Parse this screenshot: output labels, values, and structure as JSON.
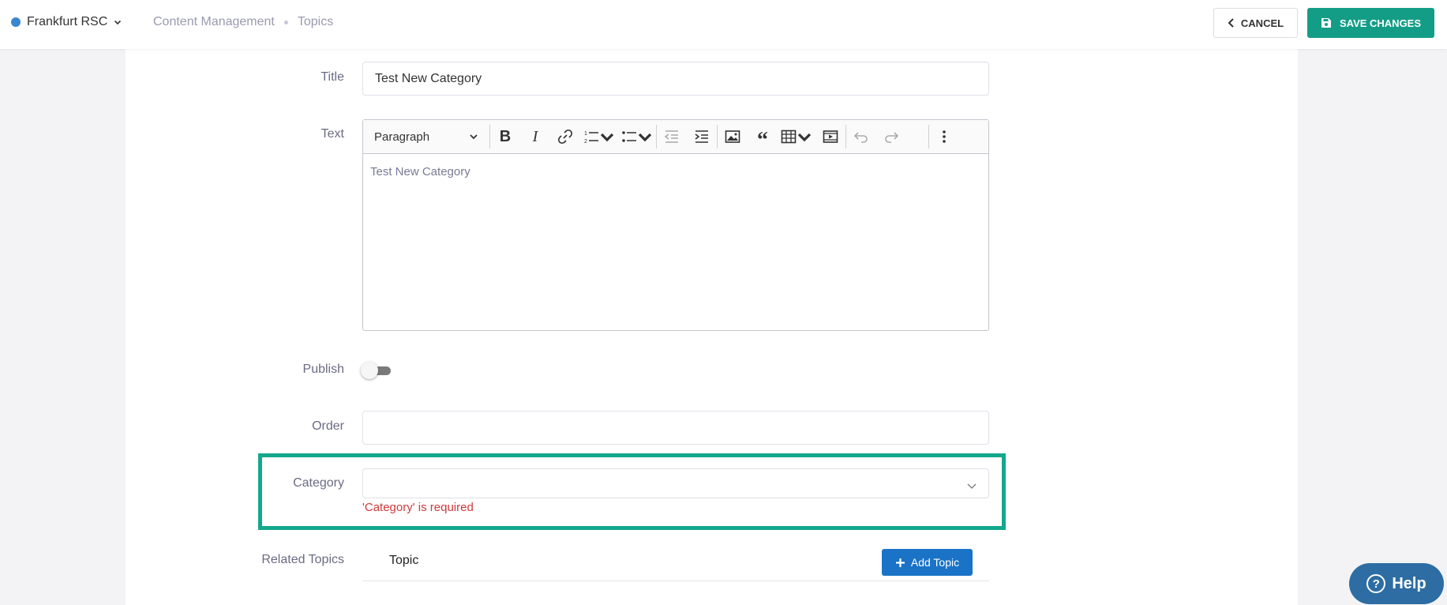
{
  "header": {
    "org_name": "Frankfurt RSC",
    "breadcrumbs": [
      "Content Management",
      "Topics"
    ],
    "cancel_label": "CANCEL",
    "save_label": "SAVE CHANGES"
  },
  "form": {
    "title_label": "Title",
    "title_value": "Test New Category",
    "text_label": "Text",
    "editor": {
      "paragraph_style": "Paragraph",
      "content": "Test New Category"
    },
    "publish_label": "Publish",
    "publish_on": false,
    "order_label": "Order",
    "order_value": "",
    "category_label": "Category",
    "category_value": "",
    "category_error": "'Category' is required",
    "related_label": "Related Topics",
    "related_column": "Topic",
    "add_topic_label": "Add Topic"
  },
  "help": {
    "label": "Help"
  },
  "colors": {
    "accent": "#149d86",
    "highlight": "#13a88c",
    "error": "#d0383a",
    "primary": "#1a73c7"
  }
}
